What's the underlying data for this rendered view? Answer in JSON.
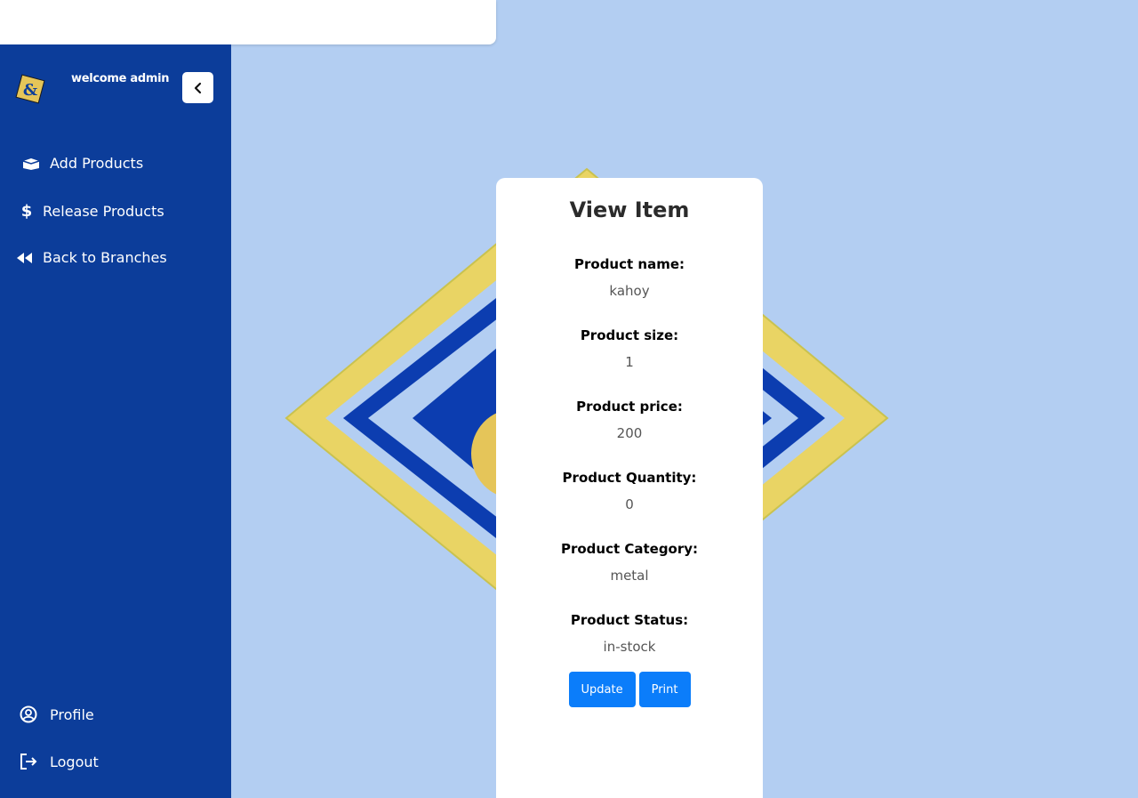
{
  "header": {
    "welcome_text": "welcome admin"
  },
  "sidebar": {
    "items": [
      {
        "label": "Add Products",
        "icon": "box-icon"
      },
      {
        "label": "Release Products",
        "icon": "dollar-icon"
      },
      {
        "label": "Back to Branches",
        "icon": "rewind-icon"
      }
    ],
    "bottom_items": [
      {
        "label": "Profile",
        "icon": "user-circle-icon"
      },
      {
        "label": "Logout",
        "icon": "logout-icon"
      }
    ]
  },
  "card": {
    "title": "View Item",
    "fields": [
      {
        "label": "Product name:",
        "value": "kahoy"
      },
      {
        "label": "Product size:",
        "value": "1"
      },
      {
        "label": "Product price:",
        "value": "200"
      },
      {
        "label": "Product Quantity:",
        "value": "0"
      },
      {
        "label": "Product Category:",
        "value": "metal"
      },
      {
        "label": "Product Status:",
        "value": "in-stock"
      }
    ],
    "update_label": "Update",
    "print_label": "Print"
  },
  "colors": {
    "sidebar": "#0c3d9a",
    "background": "#b3cef2",
    "accent_button": "#0b7dfa",
    "logo_gold": "#e5c559"
  }
}
